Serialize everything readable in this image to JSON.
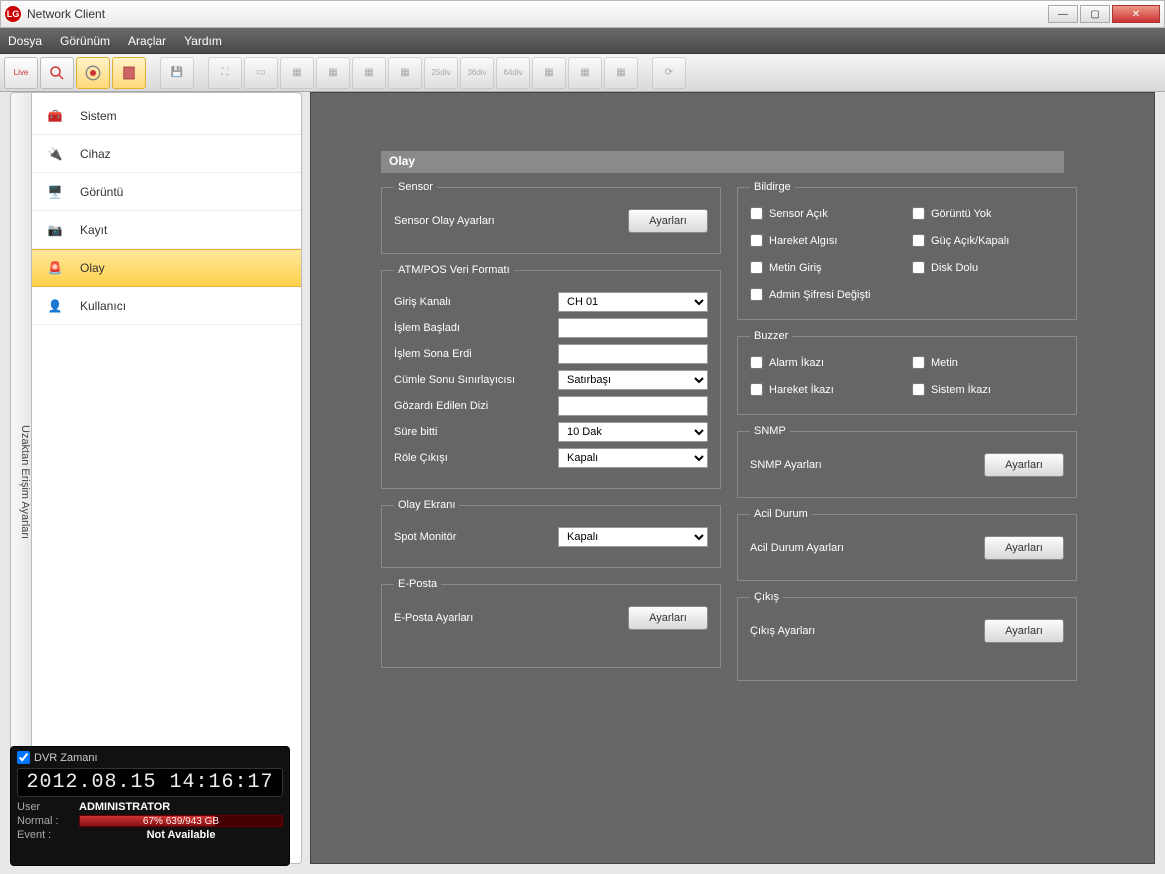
{
  "window": {
    "title": "Network Client"
  },
  "menu": {
    "file": "Dosya",
    "view": "Görünüm",
    "tools": "Araçlar",
    "help": "Yardım"
  },
  "vtab": "Uzaktan Erişim Ayarları",
  "nav": {
    "system": "Sistem",
    "device": "Cihaz",
    "display": "Görüntü",
    "record": "Kayıt",
    "event": "Olay",
    "user": "Kullanıcı"
  },
  "panel": {
    "title": "Olay"
  },
  "sensor": {
    "legend": "Sensor",
    "label": "Sensor Olay Ayarları",
    "button": "Ayarları"
  },
  "atm": {
    "legend": "ATM/POS Veri Formatı",
    "input_ch": "Giriş Kanalı",
    "input_ch_val": "CH 01",
    "tx_start": "İşlem Başladı",
    "tx_end": "İşlem Sona Erdi",
    "line_delim": "Cümle Sonu Sınırlayıcısı",
    "line_delim_val": "Satırbaşı",
    "ignore": "Gözardı Edilen Dizi",
    "timeout": "Süre bitti",
    "timeout_val": "10 Dak",
    "relay": "Röle Çıkışı",
    "relay_val": "Kapalı"
  },
  "eventscreen": {
    "legend": "Olay Ekranı",
    "spot": "Spot Monitör",
    "spot_val": "Kapalı"
  },
  "email": {
    "legend": "E-Posta",
    "label": "E-Posta Ayarları",
    "button": "Ayarları"
  },
  "notify": {
    "legend": "Bildirge",
    "sensor_on": "Sensor Açık",
    "no_image": "Görüntü Yok",
    "motion": "Hareket Algısı",
    "power": "Güç Açık/Kapalı",
    "text_in": "Metin Giriş",
    "disk_full": "Disk Dolu",
    "admin_pw": "Admin Şifresi Değişti"
  },
  "buzzer": {
    "legend": "Buzzer",
    "alarm": "Alarm İkazı",
    "text": "Metin",
    "motion": "Hareket İkazı",
    "system": "Sistem İkazı"
  },
  "snmp": {
    "legend": "SNMP",
    "label": "SNMP Ayarları",
    "button": "Ayarları"
  },
  "emergency": {
    "legend": "Acil Durum",
    "label": "Acil Durum Ayarları",
    "button": "Ayarları"
  },
  "output": {
    "legend": "Çıkış",
    "label": "Çıkış Ayarları",
    "button": "Ayarları"
  },
  "status": {
    "dvr_time_label": "DVR Zamanı",
    "clock": "2012.08.15  14:16:17",
    "user_k": "User",
    "user_v": "ADMINISTRATOR",
    "normal_k": "Normal :",
    "normal_v": "67% 639/943 GB",
    "event_k": "Event   :",
    "event_v": "Not Available"
  }
}
